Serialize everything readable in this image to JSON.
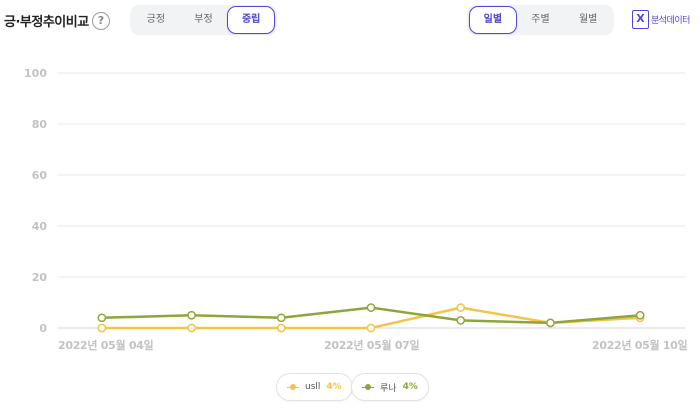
{
  "header": {
    "title": "긍·부정추이비교",
    "help_glyph": "?",
    "sentiment_tabs": [
      {
        "label": "긍정",
        "active": false
      },
      {
        "label": "부정",
        "active": false
      },
      {
        "label": "중립",
        "active": true
      }
    ],
    "period_tabs": [
      {
        "label": "일별",
        "active": true
      },
      {
        "label": "주별",
        "active": false
      },
      {
        "label": "월별",
        "active": false
      }
    ],
    "export_label": "분석데이터",
    "export_glyph": "X"
  },
  "colors": {
    "accent": "#4f47d8",
    "series_1": "#f2c44b",
    "series_2": "#8da63a"
  },
  "chart_data": {
    "type": "line",
    "ylim": [
      0,
      100
    ],
    "y_ticks": [
      "100",
      "80",
      "60",
      "40",
      "20",
      "0"
    ],
    "x": [
      "2022-05-04",
      "2022-05-05",
      "2022-05-06",
      "2022-05-07",
      "2022-05-08",
      "2022-05-09",
      "2022-05-10"
    ],
    "x_tick_labels": [
      "2022년 05월 04일",
      "2022년 05월 07일",
      "2022년 05월 10일"
    ],
    "series": [
      {
        "name": "usll",
        "legend_value": "4%",
        "values": [
          0,
          0,
          0,
          0,
          8,
          2,
          4
        ]
      },
      {
        "name": "루나",
        "legend_value": "4%",
        "values": [
          4,
          5,
          4,
          8,
          3,
          2,
          5
        ]
      }
    ],
    "grid": true,
    "legend_position": "bottom-center"
  }
}
